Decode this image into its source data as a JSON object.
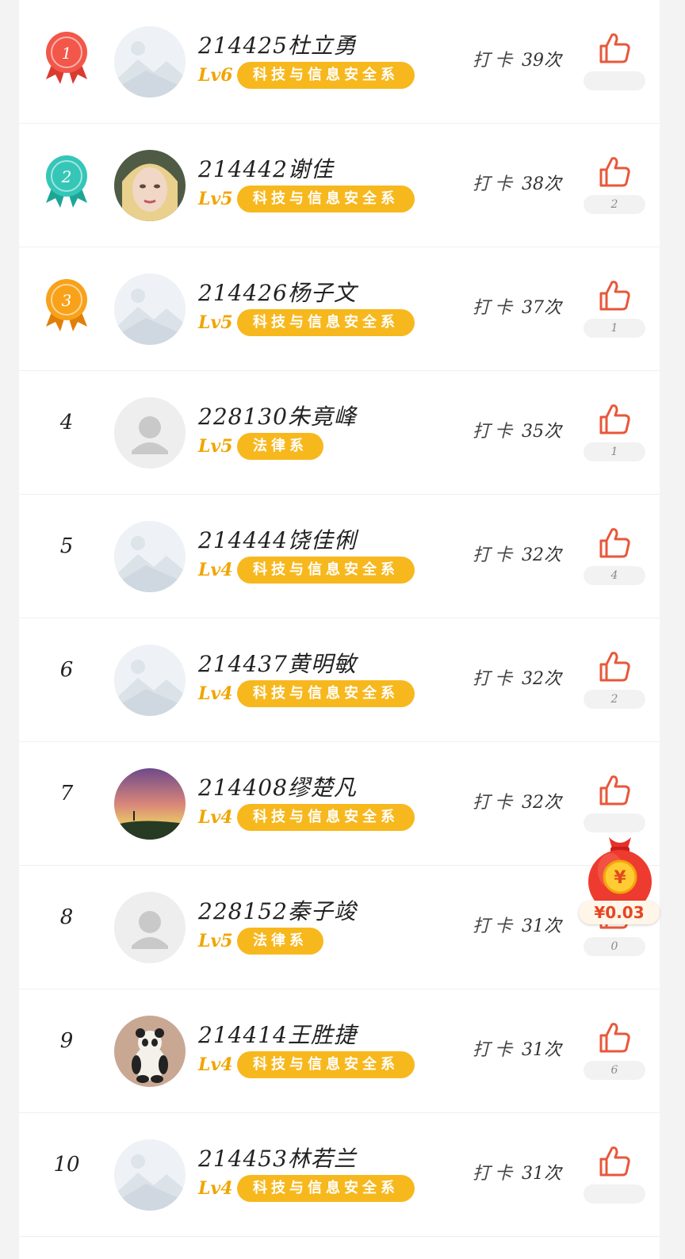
{
  "checkin_label": "打卡",
  "accent_color": "#f7b81e",
  "like_color": "#e8573a",
  "red_packet": {
    "amount": "¥0.03",
    "icon": "red-packet-icon"
  },
  "rows": [
    {
      "rank": "1",
      "medal": "red",
      "name": "214425杜立勇",
      "level": "Lv6",
      "department": "科技与信息安全系",
      "checkins": "39次",
      "likes": "",
      "avatar": "placeholder-landscape"
    },
    {
      "rank": "2",
      "medal": "teal",
      "name": "214442谢佳",
      "level": "Lv5",
      "department": "科技与信息安全系",
      "checkins": "38次",
      "likes": "2",
      "avatar": "photo-face"
    },
    {
      "rank": "3",
      "medal": "orange",
      "name": "214426杨子文",
      "level": "Lv5",
      "department": "科技与信息安全系",
      "checkins": "37次",
      "likes": "1",
      "avatar": "placeholder-landscape"
    },
    {
      "rank": "4",
      "medal": "",
      "name": "228130朱竟峰",
      "level": "Lv5",
      "department": "法律系",
      "checkins": "35次",
      "likes": "1",
      "avatar": "placeholder-person"
    },
    {
      "rank": "5",
      "medal": "",
      "name": "214444饶佳俐",
      "level": "Lv4",
      "department": "科技与信息安全系",
      "checkins": "32次",
      "likes": "4",
      "avatar": "placeholder-landscape"
    },
    {
      "rank": "6",
      "medal": "",
      "name": "214437黄明敏",
      "level": "Lv4",
      "department": "科技与信息安全系",
      "checkins": "32次",
      "likes": "2",
      "avatar": "placeholder-landscape"
    },
    {
      "rank": "7",
      "medal": "",
      "name": "214408缪楚凡",
      "level": "Lv4",
      "department": "科技与信息安全系",
      "checkins": "32次",
      "likes": "",
      "avatar": "photo-sky"
    },
    {
      "rank": "8",
      "medal": "",
      "name": "228152秦子竣",
      "level": "Lv5",
      "department": "法律系",
      "checkins": "31次",
      "likes": "0",
      "avatar": "placeholder-person"
    },
    {
      "rank": "9",
      "medal": "",
      "name": "214414王胜捷",
      "level": "Lv4",
      "department": "科技与信息安全系",
      "checkins": "31次",
      "likes": "6",
      "avatar": "photo-panda"
    },
    {
      "rank": "10",
      "medal": "",
      "name": "214453林若兰",
      "level": "Lv4",
      "department": "科技与信息安全系",
      "checkins": "31次",
      "likes": "",
      "avatar": "placeholder-landscape"
    }
  ]
}
